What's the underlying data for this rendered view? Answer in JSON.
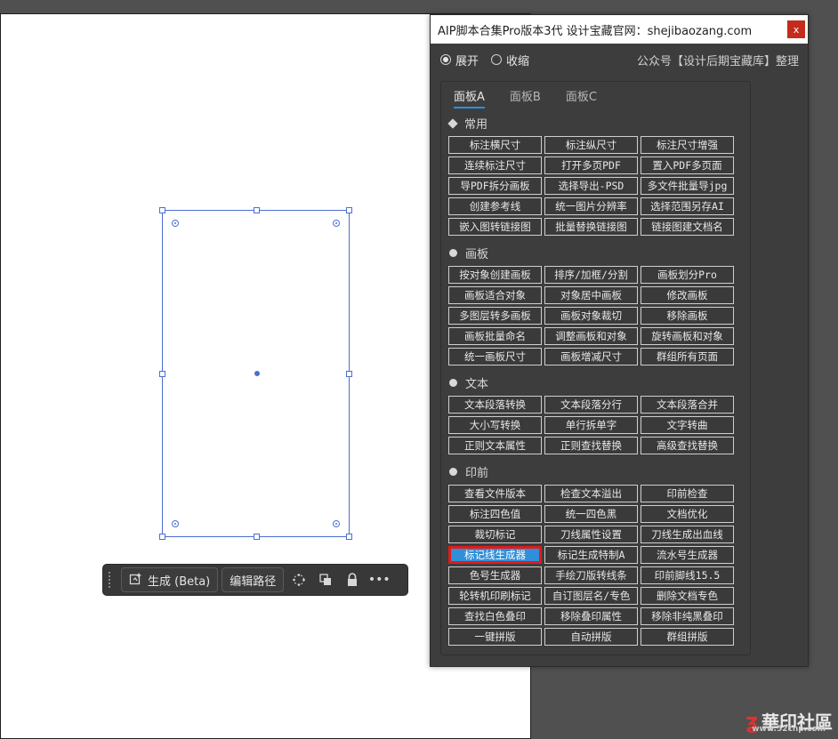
{
  "panel": {
    "title": "AIP脚本合集Pro版本3代 设计宝藏官网：shejibaozang.com",
    "close": "x",
    "mode_expand": "展开",
    "mode_collapse": "收缩",
    "credit": "公众号【设计后期宝藏库】整理",
    "tabs": [
      "面板A",
      "面板B",
      "面板C"
    ],
    "sections": [
      {
        "title": "常用",
        "buttons": [
          "标注横尺寸",
          "标注纵尺寸",
          "标注尺寸增强",
          "连续标注尺寸",
          "打开多页PDF",
          "置入PDF多页面",
          "导PDF拆分画板",
          "选择导出-PSD",
          "多文件批量导jpg",
          "创建参考线",
          "统一图片分辨率",
          "选择范围另存AI",
          "嵌入图转链接图",
          "批量替换链接图",
          "链接图建文档名"
        ]
      },
      {
        "title": "画板",
        "buttons": [
          "按对象创建画板",
          "排序/加框/分割",
          "画板划分Pro",
          "画板适合对象",
          "对象居中画板",
          "修改画板",
          "多图层转多画板",
          "画板对象裁切",
          "移除画板",
          "画板批量命名",
          "调整画板和对象",
          "旋转画板和对象",
          "统一画板尺寸",
          "画板增减尺寸",
          "群组所有页面"
        ]
      },
      {
        "title": "文本",
        "buttons": [
          "文本段落转换",
          "文本段落分行",
          "文本段落合并",
          "大小写转换",
          "单行拆单字",
          "文字转曲",
          "正则文本属性",
          "正则查找替换",
          "高级查找替换"
        ]
      },
      {
        "title": "印前",
        "buttons": [
          "查看文件版本",
          "检查文本溢出",
          "印前检查",
          "标注四色值",
          "统一四色黑",
          "文档优化",
          "裁切标记",
          "刀线属性设置",
          "刀线生成出血线",
          "标记线生成器",
          "标记生成特制A",
          "流水号生成器",
          "色号生成器",
          "手绘刀版转线条",
          "印前脚线15.5",
          "轮转机印刷标记",
          "自订图层名/专色",
          "删除文档专色",
          "查找白色叠印",
          "移除叠印属性",
          "移除非纯黑叠印",
          "一键拼版",
          "自动拼版",
          "群组拼版"
        ]
      }
    ],
    "selected_button": "标记线生成器"
  },
  "toolbar": {
    "generate": "生成 (Beta)",
    "edit_path": "编辑路径",
    "more": "•••"
  },
  "watermark": {
    "text": "華印社區",
    "sub": "www.52cnp.com"
  },
  "colors": {
    "accent": "#2f8fd8",
    "highlight_border": "#e01b1b",
    "selection": "#4a6fd3"
  }
}
